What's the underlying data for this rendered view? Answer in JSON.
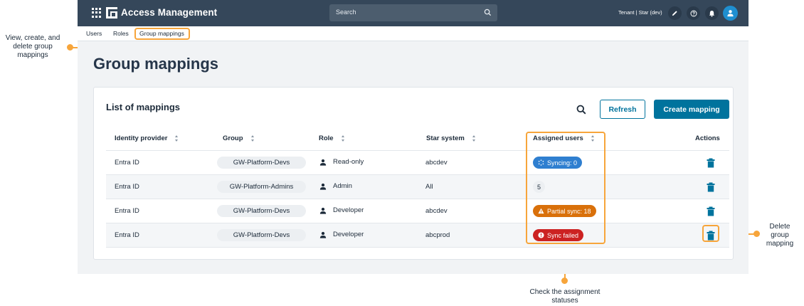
{
  "topbar": {
    "app_title": "Access Management",
    "search_placeholder": "Search",
    "tenant_label": "Tenant | Star (dev)"
  },
  "subnav": {
    "items": [
      {
        "label": "Users"
      },
      {
        "label": "Roles"
      },
      {
        "label": "Group mappings"
      }
    ]
  },
  "page": {
    "title": "Group mappings"
  },
  "card": {
    "title": "List of mappings",
    "refresh_label": "Refresh",
    "create_label": "Create mapping"
  },
  "table": {
    "columns": [
      "Identity provider",
      "Group",
      "Role",
      "Star system",
      "Assigned users",
      "Actions"
    ],
    "rows": [
      {
        "provider": "Entra ID",
        "group": "GW-Platform-Devs",
        "role": "Read-only",
        "system": "abcdev",
        "status": "Syncing: 0",
        "status_kind": "syncing"
      },
      {
        "provider": "Entra ID",
        "group": "GW-Platform-Admins",
        "role": "Admin",
        "system": "All",
        "status": "5",
        "status_kind": "plain"
      },
      {
        "provider": "Entra ID",
        "group": "GW-Platform-Devs",
        "role": "Developer",
        "system": "abcdev",
        "status": "Partial sync: 18",
        "status_kind": "partial"
      },
      {
        "provider": "Entra ID",
        "group": "GW-Platform-Devs",
        "role": "Developer",
        "system": "abcprod",
        "status": "Sync failed",
        "status_kind": "failed"
      }
    ]
  },
  "callouts": {
    "left": "View, create, and delete group mappings",
    "right": "Delete group mapping",
    "bottom": "Check the assignment statuses"
  },
  "colors": {
    "topbar": "#35475a",
    "primary": "#00739d",
    "callout": "#f7a53b",
    "syncing": "#2f7fd0",
    "partial": "#d9700a",
    "failed": "#cc2222"
  }
}
